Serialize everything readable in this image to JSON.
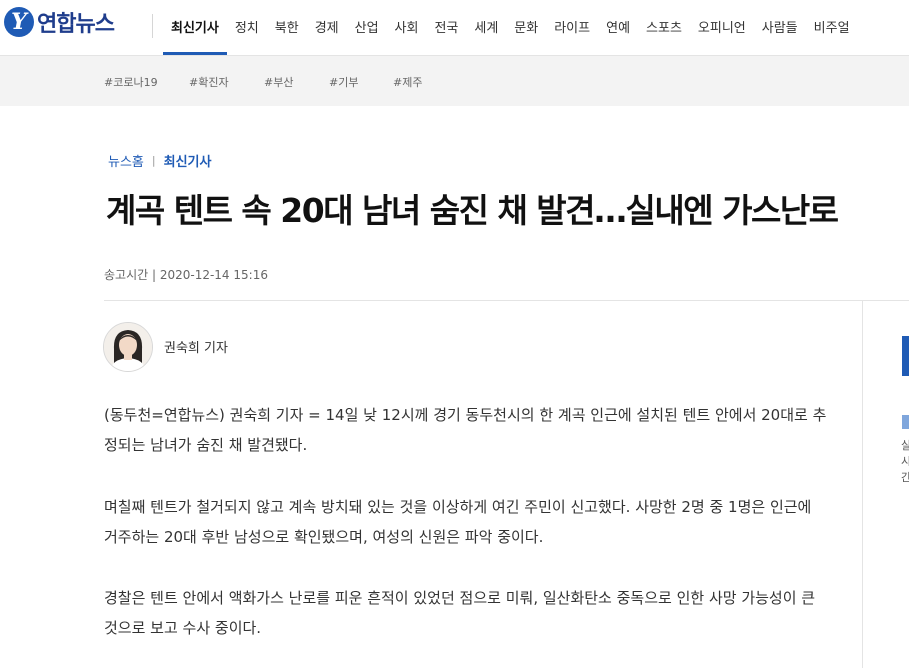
{
  "header": {
    "logo_mark": "Y",
    "logo_text": "연합뉴스",
    "nav": [
      "최신기사",
      "정치",
      "북한",
      "경제",
      "산업",
      "사회",
      "전국",
      "세계",
      "문화",
      "라이프",
      "연예",
      "스포츠",
      "오피니언",
      "사람들",
      "비주얼"
    ]
  },
  "tags": [
    "#코로나19",
    "#확진자",
    "#부산",
    "#기부",
    "#제주"
  ],
  "breadcrumb": {
    "home": "뉴스홈",
    "separator": "|",
    "current": "최신기사"
  },
  "article": {
    "headline": "계곡 텐트 속 20대 남녀 숨진 채 발견…실내엔 가스난로",
    "sent_time": "송고시간 | 2020-12-14 15:16",
    "reporter": "권숙희 기자",
    "paragraphs": [
      "(동두천=연합뉴스) 권숙희 기자 = 14일 낮 12시께 경기 동두천시의 한 계곡 인근에 설치된 텐트 안에서 20대로 추정되는 남녀가 숨진 채 발견됐다.",
      "며칠째 텐트가 철거되지 않고 계속 방치돼 있는 것을 이상하게 여긴 주민이 신고했다. 사망한 2명 중 1명은 인근에 거주하는 20대 후반 남성으로 확인됐으며, 여성의 신원은 파악 중이다.",
      "경찰은 텐트 안에서 액화가스 난로를 피운 흔적이 있었던 점으로 미뤄, 일산화탄소 중독으로 인한 사망 가능성이 큰 것으로 보고 수사 중이다."
    ]
  },
  "side": {
    "text": "실시간"
  },
  "colors": {
    "brand": "#1f5bb5",
    "tagbar_bg": "#f3f3f3"
  }
}
